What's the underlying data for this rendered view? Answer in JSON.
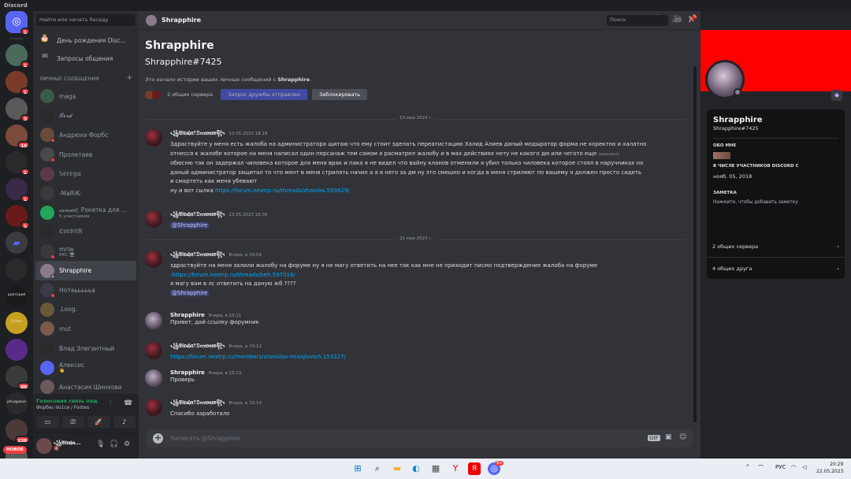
{
  "window": {
    "title": "Discord"
  },
  "servers": [
    {
      "name": "home",
      "badge": "1"
    },
    {
      "name": "s1",
      "badge": "1",
      "color": "#4a6a5a"
    },
    {
      "name": "s2",
      "badge": "1",
      "color": "#7a3a2a"
    },
    {
      "name": "s3",
      "badge": "3",
      "color": "#5a5a5a"
    },
    {
      "name": "s4",
      "badge": "19",
      "color": "#7a4a3a"
    },
    {
      "name": "s5",
      "badge": "1",
      "color": "#2a2a2a"
    },
    {
      "name": "s6",
      "badge": "1",
      "color": "#3a2a4a"
    },
    {
      "name": "s7",
      "badge": "1",
      "color": "#6a1a1a"
    },
    {
      "name": "folder",
      "badge": "",
      "color": "#3a3c41"
    },
    {
      "name": "s8",
      "badge": "",
      "color": "#2a2a2a"
    },
    {
      "name": "s9",
      "badge": "",
      "color": "#1a1a1a",
      "label": "рриторий"
    },
    {
      "name": "forbes",
      "badge": "",
      "color": "#c8a020",
      "label": "Forbes"
    },
    {
      "name": "s10",
      "badge": "",
      "color": "#5a2a8a"
    },
    {
      "name": "s11",
      "badge": "88",
      "color": "#3a3a3a"
    },
    {
      "name": "s12",
      "badge": "",
      "color": "#2a2a2a",
      "label": "рАндрюхе"
    },
    {
      "name": "s13",
      "badge": "220",
      "color": "#4a3a3a"
    },
    {
      "name": "s14",
      "badge": "",
      "color": "#5a5a5a"
    }
  ],
  "new_badge": "НОВОЕ",
  "dm_sidebar": {
    "search_placeholder": "Найти или начать беседу",
    "birthday": "День рождения Disc...",
    "requests": "Запросы общения",
    "header": "ЛИЧНЫЕ СООБЩЕНИЯ",
    "add": "+",
    "items": [
      {
        "name": "maga",
        "color": "#3a5a4a",
        "status": "",
        "sub": ""
      },
      {
        "name": "𝓛𝓸𝓻𝓭",
        "color": "#2a2a2a",
        "status": "",
        "sub": ""
      },
      {
        "name": "Андрюха Форбс",
        "color": "#6a4a3a",
        "status": "#f23f43",
        "sub": ""
      },
      {
        "name": "Пролетаев",
        "color": "#4a4a4a",
        "status": "#f23f43",
        "sub": ""
      },
      {
        "name": "𝕊𝕖𝕣𝕖𝕘𝕒",
        "color": "#5a3a4a",
        "status": "",
        "sub": ""
      },
      {
        "name": "-MaRiK-",
        "color": "#3a3a3a",
        "status": "",
        "sub": ""
      },
      {
        "name": "𝓈𝒶𝓂𝓊𝑒𝓁, Рокетка для ...",
        "color": "#23a55a",
        "status": "",
        "sub": "5 участников"
      },
      {
        "name": "ℭ𝔥𝔈𝔅𝔘ℜ",
        "color": "#2a2a2a",
        "status": "",
        "sub": ""
      },
      {
        "name": "mrlw",
        "color": "#3a3a3a",
        "status": "#f23f43",
        "sub": "ЕКС 🖥"
      },
      {
        "name": "Shrapphire",
        "color": "#8a7a8a",
        "status": "#80848e",
        "sub": "",
        "active": true
      },
      {
        "name": "Нотаьььььа",
        "color": "#3a3a4a",
        "status": "#f23f43",
        "sub": ""
      },
      {
        "name": ".Loog.",
        "color": "#6a5a3a",
        "status": "",
        "sub": ""
      },
      {
        "name": "mut",
        "color": "#7a5a4a",
        "status": "",
        "sub": ""
      },
      {
        "name": "Влад Элегантный",
        "color": "#2a2a2a",
        "status": "",
        "sub": ""
      },
      {
        "name": "Алексис",
        "color": "#5865f2",
        "status": "",
        "sub": "👋"
      },
      {
        "name": "Анастасия Шинхова",
        "color": "#6a5a5a",
        "status": "",
        "sub": ""
      }
    ]
  },
  "voice": {
    "status": "Голосовая связь под",
    "channel": "Форбес-Vo1ce / Forbes"
  },
  "user": {
    "name": "꧁𝔅𝔦𝔯𝔰𝔥𝔞...",
    "status": "🔇"
  },
  "channel": {
    "name": "Shrapphire",
    "search_placeholder": "Поиск"
  },
  "intro": {
    "name": "Shrapphire",
    "tag": "Shrapphire#7425",
    "desc_prefix": "Это начало истории ваших личных сообщений с ",
    "desc_name": "Shrapphire",
    "desc_suffix": ".",
    "mutual": "2 общих сервера",
    "friend_btn": "Запрос дружбы отправлен",
    "block_btn": "Заблокировать"
  },
  "dates": [
    "13 мая 2023 г.",
    "21 мая 2023 г."
  ],
  "messages": [
    {
      "author": "꧁𝔅𝔦𝔯𝔰𝔥𝔞☨𝔇𝔢𝔪𝔬𝔫𝔬𝔳꧂",
      "time": "13.05.2023 18:18",
      "avatar": "birsha",
      "lines": [
        "Здраствуйте у меня есть жалоба на администратора щитаю что ему стоит зделать переатистацию Халид Алиев даный модыратор форма не коректно и халатно",
        "отнесся к жалобе которое на меня написал один персанаж тем самом я расматрел жалобу и в мах действиях нету не какого дм или чегото еще",
        "обюсню так он задержал чиловека которое для меня врак и пака я не видел что вайну кланов отменили я убил только чиловека которое стоял в наручниках но",
        "даный администратор защитал то что мент в меня стрилять начил а я в него за дм ну это смешно и когда в меня стриляют по вашему я должен просто сидеть",
        "и смартеть как меня убевают",
        "ну и вот сылка "
      ],
      "edited": "(изменено)",
      "link": "https://forum.nextrp.ru/threads/zhaloba.593629/"
    },
    {
      "author": "꧁𝔅𝔦𝔯𝔰𝔥𝔞☨𝔇𝔢𝔪𝔬𝔫𝔬𝔳꧂",
      "time": "13.05.2023 18:35",
      "avatar": "birsha",
      "mention": "@Shrapphire"
    },
    {
      "author": "꧁𝔅𝔦𝔯𝔰𝔥𝔞☨𝔇𝔢𝔪𝔬𝔫𝔬𝔳꧂",
      "time": "Вчера, в 15:04",
      "avatar": "birsha",
      "line1": "здраствуйте на меня залили жалобу на форуме ну я не магу ответить на нее так как мне не приходит писмо подтверждение жалоба на форуме",
      "link": ":https://forum.nextrp.ru/threads/beh.597016/",
      "line3": "я магу вам в лс ответить на даную жб ????",
      "mention": "@Shrapphire"
    },
    {
      "author": "Shrapphire",
      "time": "Вчера, в 15:11",
      "avatar": "shra",
      "text": "Привет, дай ссылку форумник"
    },
    {
      "author": "꧁𝔅𝔦𝔯𝔰𝔥𝔞☨𝔇𝔢𝔪𝔬𝔫𝔬𝔳꧂",
      "time": "Вчера, в 15:12",
      "avatar": "birsha",
      "link": "https://forum.nextrp.ru/members/stanislav-mixajlovich.153227/"
    },
    {
      "author": "Shrapphire",
      "time": "Вчера, в 15:13",
      "avatar": "shra",
      "text": "Проверь"
    },
    {
      "author": "꧁𝔅𝔦𝔯𝔰𝔥𝔞☨𝔇𝔢𝔪𝔬𝔫𝔬𝔳꧂",
      "time": "Вчера, в 15:14",
      "avatar": "birsha",
      "text": "Спасибо заработало"
    }
  ],
  "composer": {
    "placeholder": "Написать @Shrapphire"
  },
  "profile": {
    "banner_color": "#ff0000",
    "name": "Shrapphire",
    "tag": "Shrapphire#7425",
    "about_header": "ОБО МНЕ",
    "member_header": "В ЧИСЛЕ УЧАСТНИКОВ DISCORD С",
    "member_since": "нояб. 05, 2018",
    "note_header": "ЗАМЕТКА",
    "note_placeholder": "Нажмите, чтобы добавить заметку",
    "mutual_servers": "2 общих сервера",
    "mutual_friends": "4 общих друга"
  },
  "taskbar": {
    "lang": "РУС",
    "time": "20:29",
    "date": "22.05.2023",
    "discord_badge": "9+"
  }
}
